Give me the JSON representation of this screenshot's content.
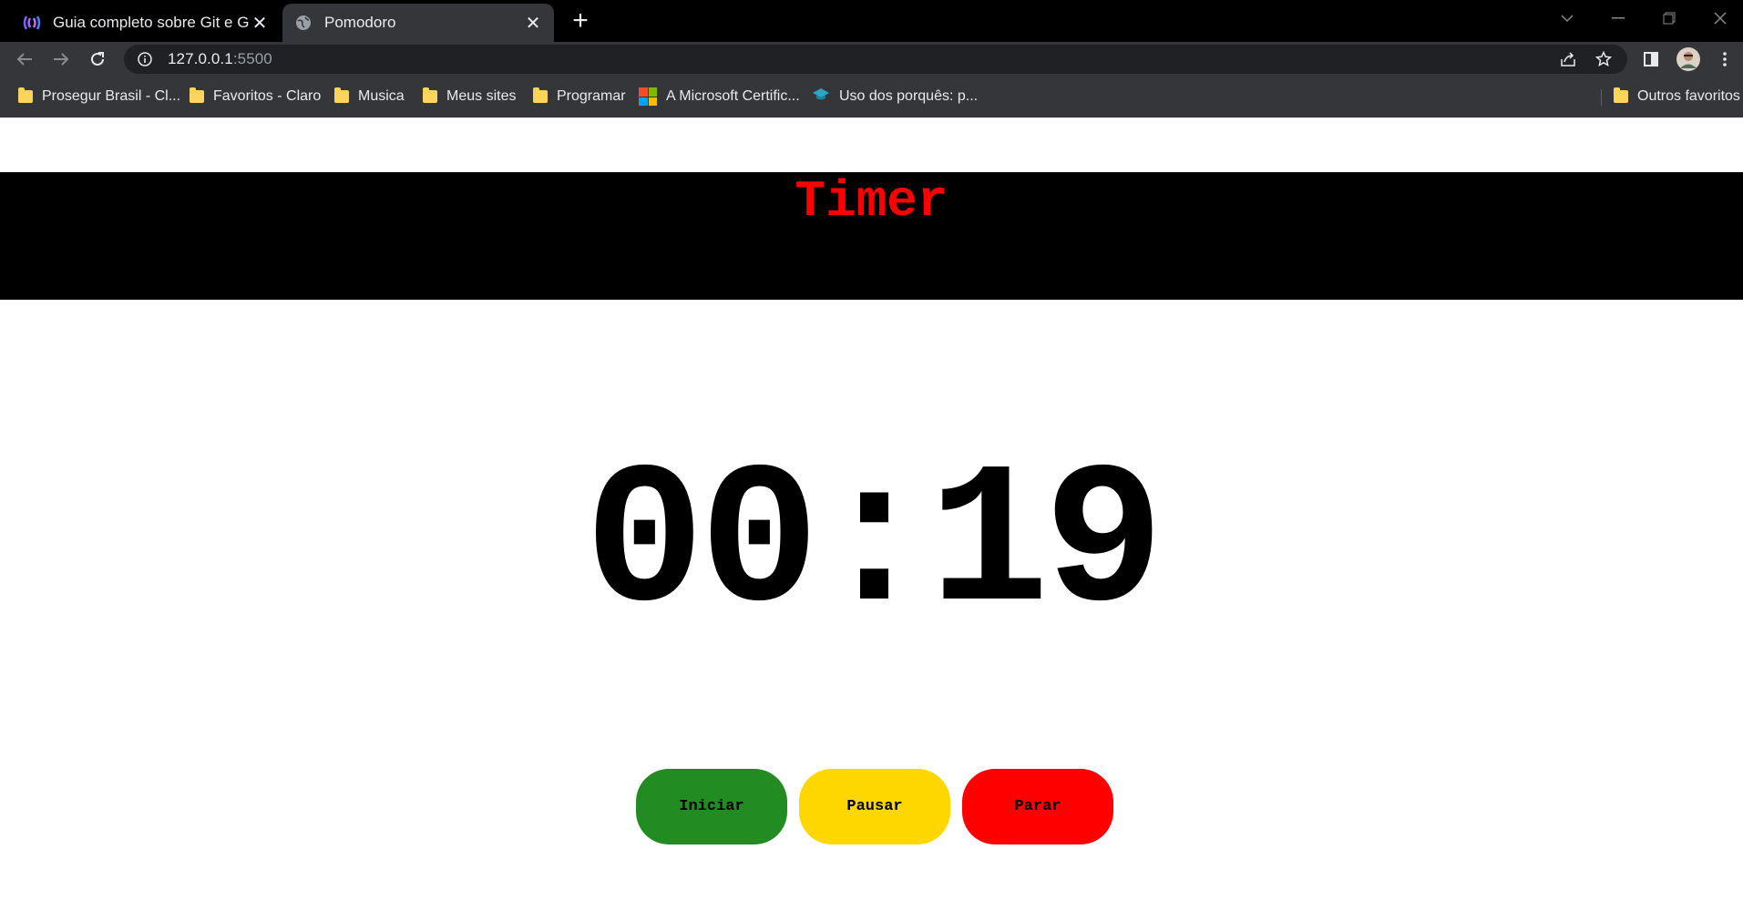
{
  "browser": {
    "tabs": [
      {
        "title": "Guia completo sobre Git e Github",
        "active": false,
        "favicon": "brand-logo-icon"
      },
      {
        "title": "Pomodoro",
        "active": true,
        "favicon": "globe-icon"
      }
    ],
    "url": {
      "host": "127.0.0.1",
      "port": ":5500"
    },
    "bookmarks": [
      {
        "label": "Prosegur Brasil - Cl...",
        "icon": "folder-icon"
      },
      {
        "label": "Favoritos - Claro",
        "icon": "folder-icon"
      },
      {
        "label": "Musica",
        "icon": "folder-icon"
      },
      {
        "label": "Meus sites",
        "icon": "folder-icon"
      },
      {
        "label": "Programar",
        "icon": "folder-icon"
      },
      {
        "label": "A Microsoft Certific...",
        "icon": "microsoft-logo-icon"
      },
      {
        "label": "Uso dos porquês: p...",
        "icon": "graduation-cap-icon"
      }
    ],
    "other_bookmarks": "Outros favoritos"
  },
  "page": {
    "title": "Timer",
    "time": "00:19",
    "buttons": {
      "start": "Iniciar",
      "pause": "Pausar",
      "stop": "Parar"
    },
    "colors": {
      "title": "#ff0000",
      "start": "#228b22",
      "pause": "#ffd700",
      "stop": "#ff0000"
    }
  }
}
